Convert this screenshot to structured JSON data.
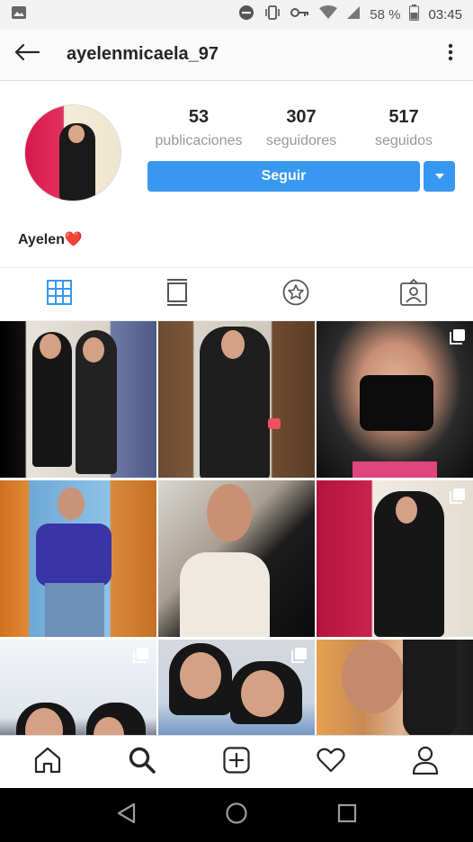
{
  "status_bar": {
    "battery_percent": "58 %",
    "time": "03:45",
    "icons": [
      "image-icon",
      "do-not-disturb-icon",
      "vibrate-icon",
      "key-icon",
      "wifi-icon",
      "signal-icon",
      "battery-icon"
    ]
  },
  "header": {
    "username": "ayelenmicaela_97",
    "back_icon": "back-arrow-icon",
    "more_icon": "more-vertical-icon"
  },
  "profile": {
    "stats": [
      {
        "value": "53",
        "label": "publicaciones"
      },
      {
        "value": "307",
        "label": "seguidores"
      },
      {
        "value": "517",
        "label": "seguidos"
      }
    ],
    "follow_label": "Seguir",
    "bio_name": "Ayelen",
    "bio_emoji": "❤️"
  },
  "tabs": [
    {
      "name": "grid-view",
      "icon": "grid-icon",
      "active": true
    },
    {
      "name": "feed-view",
      "icon": "feed-icon",
      "active": false
    },
    {
      "name": "saved",
      "icon": "star-icon",
      "active": false
    },
    {
      "name": "tagged",
      "icon": "tagged-photo-icon",
      "active": false
    }
  ],
  "grid": {
    "posts": [
      {
        "multi": false
      },
      {
        "multi": false
      },
      {
        "multi": true
      },
      {
        "multi": false
      },
      {
        "multi": false
      },
      {
        "multi": true
      },
      {
        "multi": true
      },
      {
        "multi": true
      },
      {
        "multi": false
      }
    ]
  },
  "bottom_nav": [
    "home-icon",
    "search-icon",
    "new-post-icon",
    "activity-heart-icon",
    "profile-icon"
  ],
  "colors": {
    "accent": "#3897f0",
    "status_bar": "#f2f2f2",
    "nav_bar": "#000000"
  }
}
